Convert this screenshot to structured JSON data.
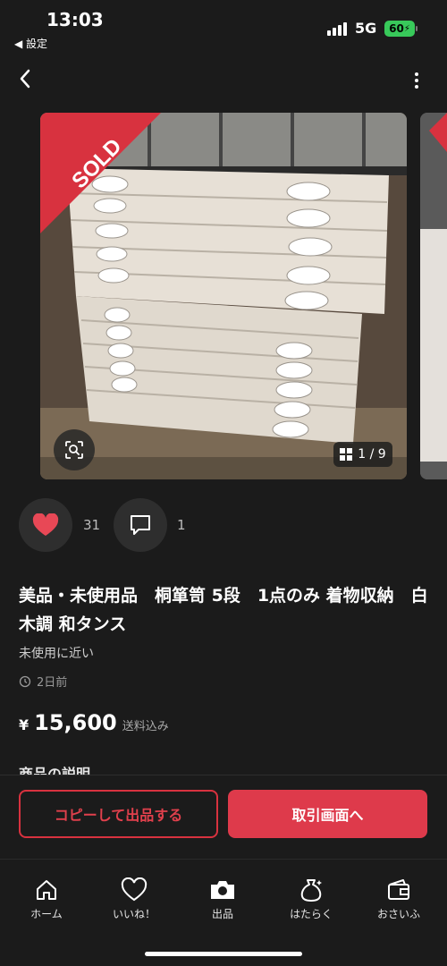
{
  "status_bar": {
    "time": "13:03",
    "back_app": "◀ 設定",
    "network": "5G",
    "battery": "60"
  },
  "listing": {
    "sold_label": "SOLD",
    "image_counter": "1 / 9",
    "like_count": "31",
    "comment_count": "1",
    "title": "美品・未使用品　桐箪笥 5段　1点のみ 着物収納　白木調 和タンス",
    "condition": "未使用に近い",
    "posted": "2日前",
    "price_symbol": "¥",
    "price": "15,600",
    "shipping": "送料込み",
    "description_heading": "商品の説明"
  },
  "actions": {
    "copy_label": "コピーして出品する",
    "trade_label": "取引画面へ"
  },
  "tabs": [
    {
      "label": "ホーム",
      "icon": "home-icon"
    },
    {
      "label": "いいね！",
      "icon": "heart-icon"
    },
    {
      "label": "出品",
      "icon": "camera-icon"
    },
    {
      "label": "はたらく",
      "icon": "money-bag-icon"
    },
    {
      "label": "おさいふ",
      "icon": "wallet-icon"
    }
  ],
  "colors": {
    "accent": "#de3a4b",
    "background": "#1b1b1b",
    "battery": "#38c95a"
  }
}
